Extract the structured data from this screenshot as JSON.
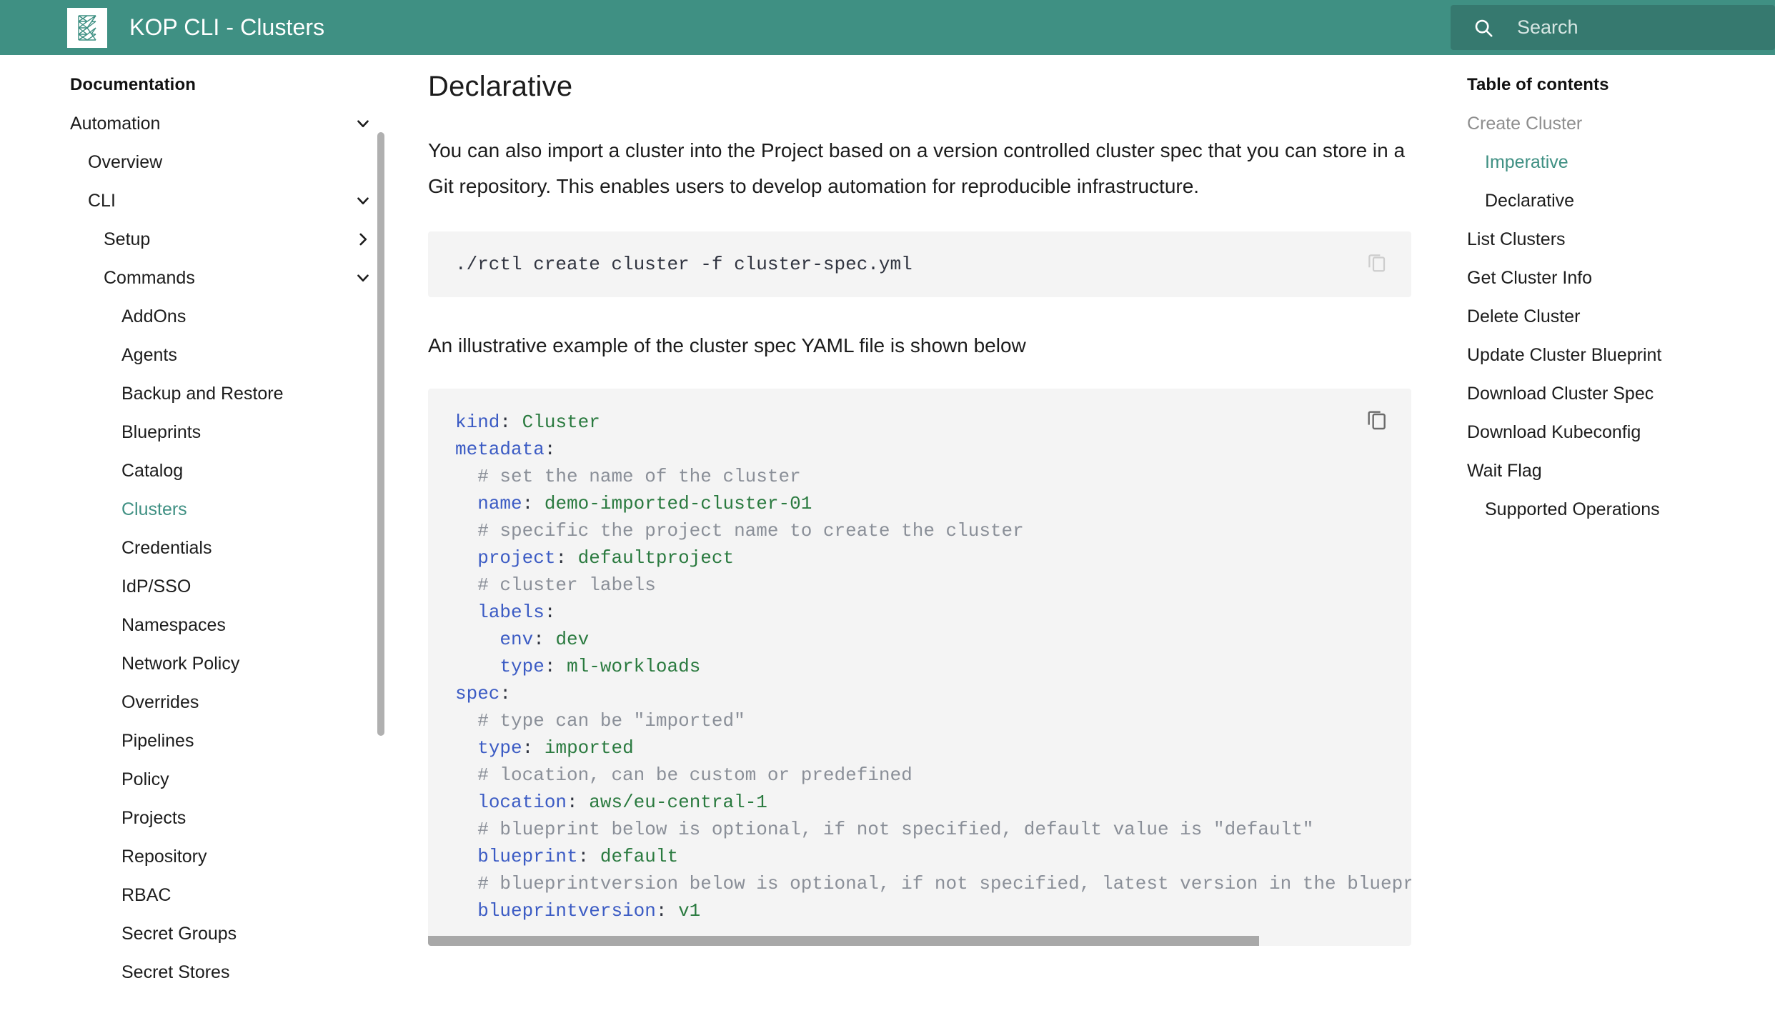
{
  "header": {
    "title": "KOP CLI - Clusters",
    "logo_icon": "rafay-triangular-mesh-logo",
    "search": {
      "icon": "search-icon",
      "placeholder": "Search",
      "value": ""
    },
    "bg_color": "#3f9083",
    "search_bg_color": "#36796f"
  },
  "sidebar": {
    "title": "Documentation",
    "accent_color": "#3f9083",
    "items": [
      {
        "label": "Automation",
        "level": 1,
        "chevron": "chevron-down-icon",
        "active": false
      },
      {
        "label": "Overview",
        "level": 2,
        "chevron": "",
        "active": false
      },
      {
        "label": "CLI",
        "level": 2,
        "chevron": "chevron-down-icon",
        "active": false
      },
      {
        "label": "Setup",
        "level": 3,
        "chevron": "chevron-right-icon",
        "active": false
      },
      {
        "label": "Commands",
        "level": 3,
        "chevron": "chevron-down-icon",
        "active": false
      },
      {
        "label": "AddOns",
        "level": 4,
        "chevron": "",
        "active": false
      },
      {
        "label": "Agents",
        "level": 4,
        "chevron": "",
        "active": false
      },
      {
        "label": "Backup and Restore",
        "level": 4,
        "chevron": "",
        "active": false
      },
      {
        "label": "Blueprints",
        "level": 4,
        "chevron": "",
        "active": false
      },
      {
        "label": "Catalog",
        "level": 4,
        "chevron": "",
        "active": false
      },
      {
        "label": "Clusters",
        "level": 4,
        "chevron": "",
        "active": true
      },
      {
        "label": "Credentials",
        "level": 4,
        "chevron": "",
        "active": false
      },
      {
        "label": "IdP/SSO",
        "level": 4,
        "chevron": "",
        "active": false
      },
      {
        "label": "Namespaces",
        "level": 4,
        "chevron": "",
        "active": false
      },
      {
        "label": "Network Policy",
        "level": 4,
        "chevron": "",
        "active": false
      },
      {
        "label": "Overrides",
        "level": 4,
        "chevron": "",
        "active": false
      },
      {
        "label": "Pipelines",
        "level": 4,
        "chevron": "",
        "active": false
      },
      {
        "label": "Policy",
        "level": 4,
        "chevron": "",
        "active": false
      },
      {
        "label": "Projects",
        "level": 4,
        "chevron": "",
        "active": false
      },
      {
        "label": "Repository",
        "level": 4,
        "chevron": "",
        "active": false
      },
      {
        "label": "RBAC",
        "level": 4,
        "chevron": "",
        "active": false
      },
      {
        "label": "Secret Groups",
        "level": 4,
        "chevron": "",
        "active": false
      },
      {
        "label": "Secret Stores",
        "level": 4,
        "chevron": "",
        "active": false
      }
    ]
  },
  "main": {
    "heading": "Declarative",
    "paragraph_1": "You can also import a cluster into the Project based on a version controlled cluster spec that you can store in a Git repository. This enables users to develop automation for reproducible infrastructure.",
    "command_block": {
      "code": "./rctl create cluster -f cluster-spec.yml",
      "copy_icon": "copy-icon"
    },
    "paragraph_2": "An illustrative example of the cluster spec YAML file is shown below",
    "yaml_block": {
      "copy_icon": "copy-icon",
      "lines": [
        [
          {
            "t": "key",
            "s": "kind"
          },
          {
            "t": "pl",
            "s": ": "
          },
          {
            "t": "val",
            "s": "Cluster"
          }
        ],
        [
          {
            "t": "key",
            "s": "metadata"
          },
          {
            "t": "pl",
            "s": ":"
          }
        ],
        [
          {
            "t": "pl",
            "s": "  "
          },
          {
            "t": "cmt",
            "s": "# set the name of the cluster"
          }
        ],
        [
          {
            "t": "pl",
            "s": "  "
          },
          {
            "t": "key",
            "s": "name"
          },
          {
            "t": "pl",
            "s": ": "
          },
          {
            "t": "val",
            "s": "demo-imported-cluster-01"
          }
        ],
        [
          {
            "t": "pl",
            "s": "  "
          },
          {
            "t": "cmt",
            "s": "# specific the project name to create the cluster"
          }
        ],
        [
          {
            "t": "pl",
            "s": "  "
          },
          {
            "t": "key",
            "s": "project"
          },
          {
            "t": "pl",
            "s": ": "
          },
          {
            "t": "val",
            "s": "defaultproject"
          }
        ],
        [
          {
            "t": "pl",
            "s": "  "
          },
          {
            "t": "cmt",
            "s": "# cluster labels"
          }
        ],
        [
          {
            "t": "pl",
            "s": "  "
          },
          {
            "t": "key",
            "s": "labels"
          },
          {
            "t": "pl",
            "s": ":"
          }
        ],
        [
          {
            "t": "pl",
            "s": "    "
          },
          {
            "t": "key",
            "s": "env"
          },
          {
            "t": "pl",
            "s": ": "
          },
          {
            "t": "val",
            "s": "dev"
          }
        ],
        [
          {
            "t": "pl",
            "s": "    "
          },
          {
            "t": "key",
            "s": "type"
          },
          {
            "t": "pl",
            "s": ": "
          },
          {
            "t": "val",
            "s": "ml-workloads"
          }
        ],
        [
          {
            "t": "key",
            "s": "spec"
          },
          {
            "t": "pl",
            "s": ":"
          }
        ],
        [
          {
            "t": "pl",
            "s": "  "
          },
          {
            "t": "cmt",
            "s": "# type can be \"imported\""
          }
        ],
        [
          {
            "t": "pl",
            "s": "  "
          },
          {
            "t": "key",
            "s": "type"
          },
          {
            "t": "pl",
            "s": ": "
          },
          {
            "t": "val",
            "s": "imported"
          }
        ],
        [
          {
            "t": "pl",
            "s": "  "
          },
          {
            "t": "cmt",
            "s": "# location, can be custom or predefined"
          }
        ],
        [
          {
            "t": "pl",
            "s": "  "
          },
          {
            "t": "key",
            "s": "location"
          },
          {
            "t": "pl",
            "s": ": "
          },
          {
            "t": "val",
            "s": "aws/eu-central-1"
          }
        ],
        [
          {
            "t": "pl",
            "s": "  "
          },
          {
            "t": "cmt",
            "s": "# blueprint below is optional, if not specified, default value is \"default\""
          }
        ],
        [
          {
            "t": "pl",
            "s": "  "
          },
          {
            "t": "key",
            "s": "blueprint"
          },
          {
            "t": "pl",
            "s": ": "
          },
          {
            "t": "val",
            "s": "default"
          }
        ],
        [
          {
            "t": "pl",
            "s": "  "
          },
          {
            "t": "cmt",
            "s": "# blueprintversion below is optional, if not specified, latest version in the blueprint is used"
          }
        ],
        [
          {
            "t": "pl",
            "s": "  "
          },
          {
            "t": "key",
            "s": "blueprintversion"
          },
          {
            "t": "pl",
            "s": ": "
          },
          {
            "t": "val",
            "s": "v1"
          }
        ]
      ]
    }
  },
  "toc": {
    "title": "Table of contents",
    "accent_color": "#3f9083",
    "items": [
      {
        "label": "Create Cluster",
        "level": 1,
        "state": "muted"
      },
      {
        "label": "Imperative",
        "level": 2,
        "state": "active"
      },
      {
        "label": "Declarative",
        "level": 2,
        "state": "normal"
      },
      {
        "label": "List Clusters",
        "level": 1,
        "state": "normal"
      },
      {
        "label": "Get Cluster Info",
        "level": 1,
        "state": "normal"
      },
      {
        "label": "Delete Cluster",
        "level": 1,
        "state": "normal"
      },
      {
        "label": "Update Cluster Blueprint",
        "level": 1,
        "state": "normal"
      },
      {
        "label": "Download Cluster Spec",
        "level": 1,
        "state": "normal"
      },
      {
        "label": "Download Kubeconfig",
        "level": 1,
        "state": "normal"
      },
      {
        "label": "Wait Flag",
        "level": 1,
        "state": "normal"
      },
      {
        "label": "Supported Operations",
        "level": 2,
        "state": "normal"
      }
    ]
  }
}
